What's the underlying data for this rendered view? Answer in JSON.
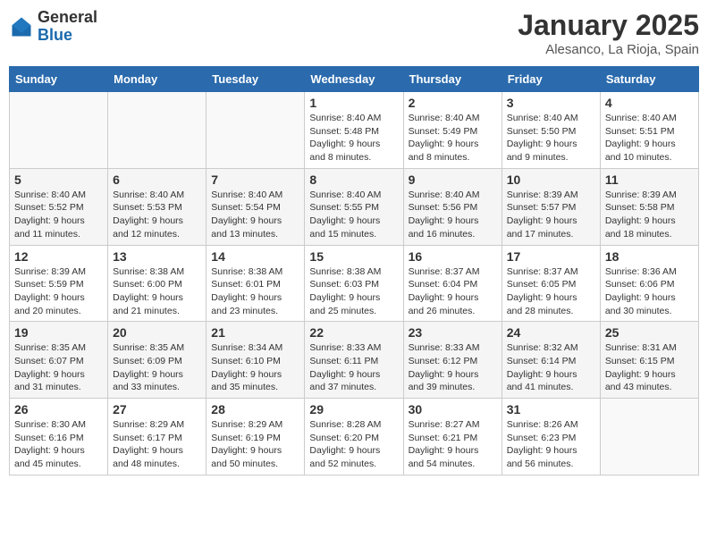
{
  "header": {
    "logo_general": "General",
    "logo_blue": "Blue",
    "month_year": "January 2025",
    "location": "Alesanco, La Rioja, Spain"
  },
  "weekdays": [
    "Sunday",
    "Monday",
    "Tuesday",
    "Wednesday",
    "Thursday",
    "Friday",
    "Saturday"
  ],
  "weeks": [
    [
      {
        "day": "",
        "sunrise": "",
        "sunset": "",
        "daylight": ""
      },
      {
        "day": "",
        "sunrise": "",
        "sunset": "",
        "daylight": ""
      },
      {
        "day": "",
        "sunrise": "",
        "sunset": "",
        "daylight": ""
      },
      {
        "day": "1",
        "sunrise": "Sunrise: 8:40 AM",
        "sunset": "Sunset: 5:48 PM",
        "daylight": "Daylight: 9 hours and 8 minutes."
      },
      {
        "day": "2",
        "sunrise": "Sunrise: 8:40 AM",
        "sunset": "Sunset: 5:49 PM",
        "daylight": "Daylight: 9 hours and 8 minutes."
      },
      {
        "day": "3",
        "sunrise": "Sunrise: 8:40 AM",
        "sunset": "Sunset: 5:50 PM",
        "daylight": "Daylight: 9 hours and 9 minutes."
      },
      {
        "day": "4",
        "sunrise": "Sunrise: 8:40 AM",
        "sunset": "Sunset: 5:51 PM",
        "daylight": "Daylight: 9 hours and 10 minutes."
      }
    ],
    [
      {
        "day": "5",
        "sunrise": "Sunrise: 8:40 AM",
        "sunset": "Sunset: 5:52 PM",
        "daylight": "Daylight: 9 hours and 11 minutes."
      },
      {
        "day": "6",
        "sunrise": "Sunrise: 8:40 AM",
        "sunset": "Sunset: 5:53 PM",
        "daylight": "Daylight: 9 hours and 12 minutes."
      },
      {
        "day": "7",
        "sunrise": "Sunrise: 8:40 AM",
        "sunset": "Sunset: 5:54 PM",
        "daylight": "Daylight: 9 hours and 13 minutes."
      },
      {
        "day": "8",
        "sunrise": "Sunrise: 8:40 AM",
        "sunset": "Sunset: 5:55 PM",
        "daylight": "Daylight: 9 hours and 15 minutes."
      },
      {
        "day": "9",
        "sunrise": "Sunrise: 8:40 AM",
        "sunset": "Sunset: 5:56 PM",
        "daylight": "Daylight: 9 hours and 16 minutes."
      },
      {
        "day": "10",
        "sunrise": "Sunrise: 8:39 AM",
        "sunset": "Sunset: 5:57 PM",
        "daylight": "Daylight: 9 hours and 17 minutes."
      },
      {
        "day": "11",
        "sunrise": "Sunrise: 8:39 AM",
        "sunset": "Sunset: 5:58 PM",
        "daylight": "Daylight: 9 hours and 18 minutes."
      }
    ],
    [
      {
        "day": "12",
        "sunrise": "Sunrise: 8:39 AM",
        "sunset": "Sunset: 5:59 PM",
        "daylight": "Daylight: 9 hours and 20 minutes."
      },
      {
        "day": "13",
        "sunrise": "Sunrise: 8:38 AM",
        "sunset": "Sunset: 6:00 PM",
        "daylight": "Daylight: 9 hours and 21 minutes."
      },
      {
        "day": "14",
        "sunrise": "Sunrise: 8:38 AM",
        "sunset": "Sunset: 6:01 PM",
        "daylight": "Daylight: 9 hours and 23 minutes."
      },
      {
        "day": "15",
        "sunrise": "Sunrise: 8:38 AM",
        "sunset": "Sunset: 6:03 PM",
        "daylight": "Daylight: 9 hours and 25 minutes."
      },
      {
        "day": "16",
        "sunrise": "Sunrise: 8:37 AM",
        "sunset": "Sunset: 6:04 PM",
        "daylight": "Daylight: 9 hours and 26 minutes."
      },
      {
        "day": "17",
        "sunrise": "Sunrise: 8:37 AM",
        "sunset": "Sunset: 6:05 PM",
        "daylight": "Daylight: 9 hours and 28 minutes."
      },
      {
        "day": "18",
        "sunrise": "Sunrise: 8:36 AM",
        "sunset": "Sunset: 6:06 PM",
        "daylight": "Daylight: 9 hours and 30 minutes."
      }
    ],
    [
      {
        "day": "19",
        "sunrise": "Sunrise: 8:35 AM",
        "sunset": "Sunset: 6:07 PM",
        "daylight": "Daylight: 9 hours and 31 minutes."
      },
      {
        "day": "20",
        "sunrise": "Sunrise: 8:35 AM",
        "sunset": "Sunset: 6:09 PM",
        "daylight": "Daylight: 9 hours and 33 minutes."
      },
      {
        "day": "21",
        "sunrise": "Sunrise: 8:34 AM",
        "sunset": "Sunset: 6:10 PM",
        "daylight": "Daylight: 9 hours and 35 minutes."
      },
      {
        "day": "22",
        "sunrise": "Sunrise: 8:33 AM",
        "sunset": "Sunset: 6:11 PM",
        "daylight": "Daylight: 9 hours and 37 minutes."
      },
      {
        "day": "23",
        "sunrise": "Sunrise: 8:33 AM",
        "sunset": "Sunset: 6:12 PM",
        "daylight": "Daylight: 9 hours and 39 minutes."
      },
      {
        "day": "24",
        "sunrise": "Sunrise: 8:32 AM",
        "sunset": "Sunset: 6:14 PM",
        "daylight": "Daylight: 9 hours and 41 minutes."
      },
      {
        "day": "25",
        "sunrise": "Sunrise: 8:31 AM",
        "sunset": "Sunset: 6:15 PM",
        "daylight": "Daylight: 9 hours and 43 minutes."
      }
    ],
    [
      {
        "day": "26",
        "sunrise": "Sunrise: 8:30 AM",
        "sunset": "Sunset: 6:16 PM",
        "daylight": "Daylight: 9 hours and 45 minutes."
      },
      {
        "day": "27",
        "sunrise": "Sunrise: 8:29 AM",
        "sunset": "Sunset: 6:17 PM",
        "daylight": "Daylight: 9 hours and 48 minutes."
      },
      {
        "day": "28",
        "sunrise": "Sunrise: 8:29 AM",
        "sunset": "Sunset: 6:19 PM",
        "daylight": "Daylight: 9 hours and 50 minutes."
      },
      {
        "day": "29",
        "sunrise": "Sunrise: 8:28 AM",
        "sunset": "Sunset: 6:20 PM",
        "daylight": "Daylight: 9 hours and 52 minutes."
      },
      {
        "day": "30",
        "sunrise": "Sunrise: 8:27 AM",
        "sunset": "Sunset: 6:21 PM",
        "daylight": "Daylight: 9 hours and 54 minutes."
      },
      {
        "day": "31",
        "sunrise": "Sunrise: 8:26 AM",
        "sunset": "Sunset: 6:23 PM",
        "daylight": "Daylight: 9 hours and 56 minutes."
      },
      {
        "day": "",
        "sunrise": "",
        "sunset": "",
        "daylight": ""
      }
    ]
  ]
}
